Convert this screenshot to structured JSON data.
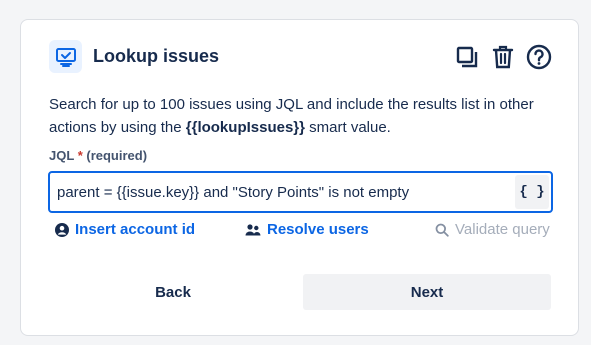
{
  "card": {
    "icon": "monitor-check-icon",
    "title": "Lookup issues",
    "actions": [
      {
        "icon": "duplicate-icon"
      },
      {
        "icon": "trash-icon"
      },
      {
        "icon": "help-icon"
      }
    ],
    "description_prefix": "Search for up to 100 issues using JQL and include the results list in other actions by using the ",
    "description_smart_value": "{{lookupIssues}}",
    "description_suffix": " smart value."
  },
  "jql": {
    "label": "JQL",
    "required_marker": "*",
    "required_text": "(required)",
    "value": "parent = {{issue.key}} and \"Story Points\" is not empty",
    "smart_value_button": "{ }"
  },
  "links": {
    "insert_account_id": "Insert account id",
    "resolve_users": "Resolve users",
    "validate_query": "Validate query"
  },
  "footer": {
    "back_label": "Back",
    "next_label": "Next"
  },
  "colors": {
    "accent": "#0c66e4",
    "required": "#c9372c",
    "disabled": "#a5adba"
  }
}
